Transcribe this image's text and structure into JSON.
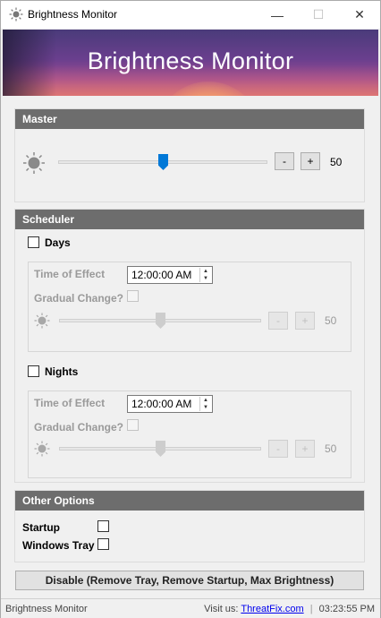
{
  "window": {
    "title": "Brightness Monitor",
    "controls": {
      "minimize": "—",
      "maximize": "☐",
      "close": "✕"
    }
  },
  "banner": {
    "title": "Brightness Monitor"
  },
  "master": {
    "header": "Master",
    "slider_level_percent": 50,
    "minus_label": "-",
    "plus_label": "+",
    "value": "50"
  },
  "scheduler": {
    "header": "Scheduler",
    "days": {
      "label": "Days",
      "checked": false,
      "time_label": "Time of Effect",
      "time_value": "12:00:00 AM",
      "gradual_label": "Gradual Change?",
      "slider_level_percent": 50,
      "minus_label": "-",
      "plus_label": "+",
      "value": "50"
    },
    "nights": {
      "label": "Nights",
      "checked": false,
      "time_label": "Time of Effect",
      "time_value": "12:00:00 AM",
      "gradual_label": "Gradual Change?",
      "slider_level_percent": 50,
      "minus_label": "-",
      "plus_label": "+",
      "value": "50"
    }
  },
  "other_options": {
    "header": "Other Options",
    "startup_label": "Startup",
    "windows_tray_label": "Windows Tray"
  },
  "disable_button": "Disable (Remove Tray, Remove Startup, Max Brightness)",
  "statusbar": {
    "app_name": "Brightness Monitor",
    "visit_label": "Visit us:",
    "link": "ThreatFix.com",
    "separator": "|",
    "time": "03:23:55 PM"
  },
  "colors": {
    "accent": "#0078d7",
    "section_header": "#6d6d6d",
    "link": "#0000ee"
  }
}
